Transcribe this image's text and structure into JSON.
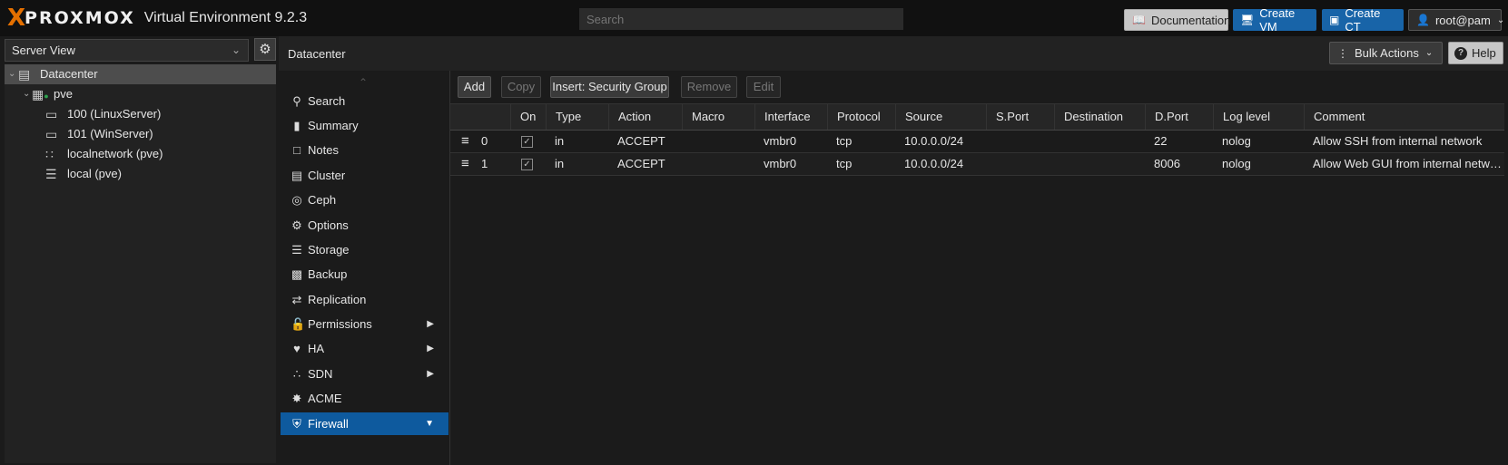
{
  "header": {
    "logo_x": "X",
    "logo_text": "PROXMOX",
    "product": "Virtual Environment 9.2.3",
    "search_placeholder": "Search",
    "documentation_label": "Documentation",
    "create_vm_label": "Create VM",
    "create_ct_label": "Create CT",
    "user_label": "root@pam"
  },
  "sidebar": {
    "view_select": "Server View",
    "tree": [
      {
        "label": "Datacenter",
        "icon": "server-rack-icon",
        "level": 0,
        "selected": true
      },
      {
        "label": "pve",
        "icon": "node-online-icon",
        "level": 1,
        "selected": false
      },
      {
        "label": "100 (LinuxServer)",
        "icon": "monitor-icon",
        "level": 2,
        "selected": false
      },
      {
        "label": "101 (WinServer)",
        "icon": "monitor-icon",
        "level": 2,
        "selected": false
      },
      {
        "label": "localnetwork (pve)",
        "icon": "network-grid-icon",
        "level": 2,
        "selected": false
      },
      {
        "label": "local (pve)",
        "icon": "storage-icon",
        "level": 2,
        "selected": false
      }
    ]
  },
  "breadcrumb": {
    "title": "Datacenter",
    "bulk_actions_label": "Bulk Actions",
    "help_label": "Help"
  },
  "nav": {
    "items": [
      {
        "label": "Search",
        "icon": "search-icon",
        "expandable": false
      },
      {
        "label": "Summary",
        "icon": "book-icon",
        "expandable": false
      },
      {
        "label": "Notes",
        "icon": "note-icon",
        "expandable": false
      },
      {
        "label": "Cluster",
        "icon": "server-icon",
        "expandable": false
      },
      {
        "label": "Ceph",
        "icon": "ceph-icon",
        "expandable": false
      },
      {
        "label": "Options",
        "icon": "gear-icon",
        "expandable": false
      },
      {
        "label": "Storage",
        "icon": "database-icon",
        "expandable": false
      },
      {
        "label": "Backup",
        "icon": "floppy-icon",
        "expandable": false
      },
      {
        "label": "Replication",
        "icon": "retweet-icon",
        "expandable": false
      },
      {
        "label": "Permissions",
        "icon": "unlock-icon",
        "expandable": true
      },
      {
        "label": "HA",
        "icon": "heartbeat-icon",
        "expandable": true
      },
      {
        "label": "SDN",
        "icon": "sdn-icon",
        "expandable": true
      },
      {
        "label": "ACME",
        "icon": "certificate-icon",
        "expandable": false
      },
      {
        "label": "Firewall",
        "icon": "shield-icon",
        "expandable": true,
        "active": true
      }
    ]
  },
  "firewall": {
    "toolbar": {
      "add": "Add",
      "copy": "Copy",
      "insert_group": "Insert: Security Group",
      "remove": "Remove",
      "edit": "Edit"
    },
    "columns": [
      "On",
      "Type",
      "Action",
      "Macro",
      "Interface",
      "Protocol",
      "Source",
      "S.Port",
      "Destination",
      "D.Port",
      "Log level",
      "Comment"
    ],
    "rules": [
      {
        "pos": "0",
        "on": true,
        "type": "in",
        "action": "ACCEPT",
        "macro": "",
        "iface": "vmbr0",
        "proto": "tcp",
        "source": "10.0.0.0/24",
        "sport": "",
        "dest": "",
        "dport": "22",
        "log": "nolog",
        "comment": "Allow SSH from internal network"
      },
      {
        "pos": "1",
        "on": true,
        "type": "in",
        "action": "ACCEPT",
        "macro": "",
        "iface": "vmbr0",
        "proto": "tcp",
        "source": "10.0.0.0/24",
        "sport": "",
        "dest": "",
        "dport": "8006",
        "log": "nolog",
        "comment": "Allow Web GUI from internal network"
      }
    ]
  }
}
